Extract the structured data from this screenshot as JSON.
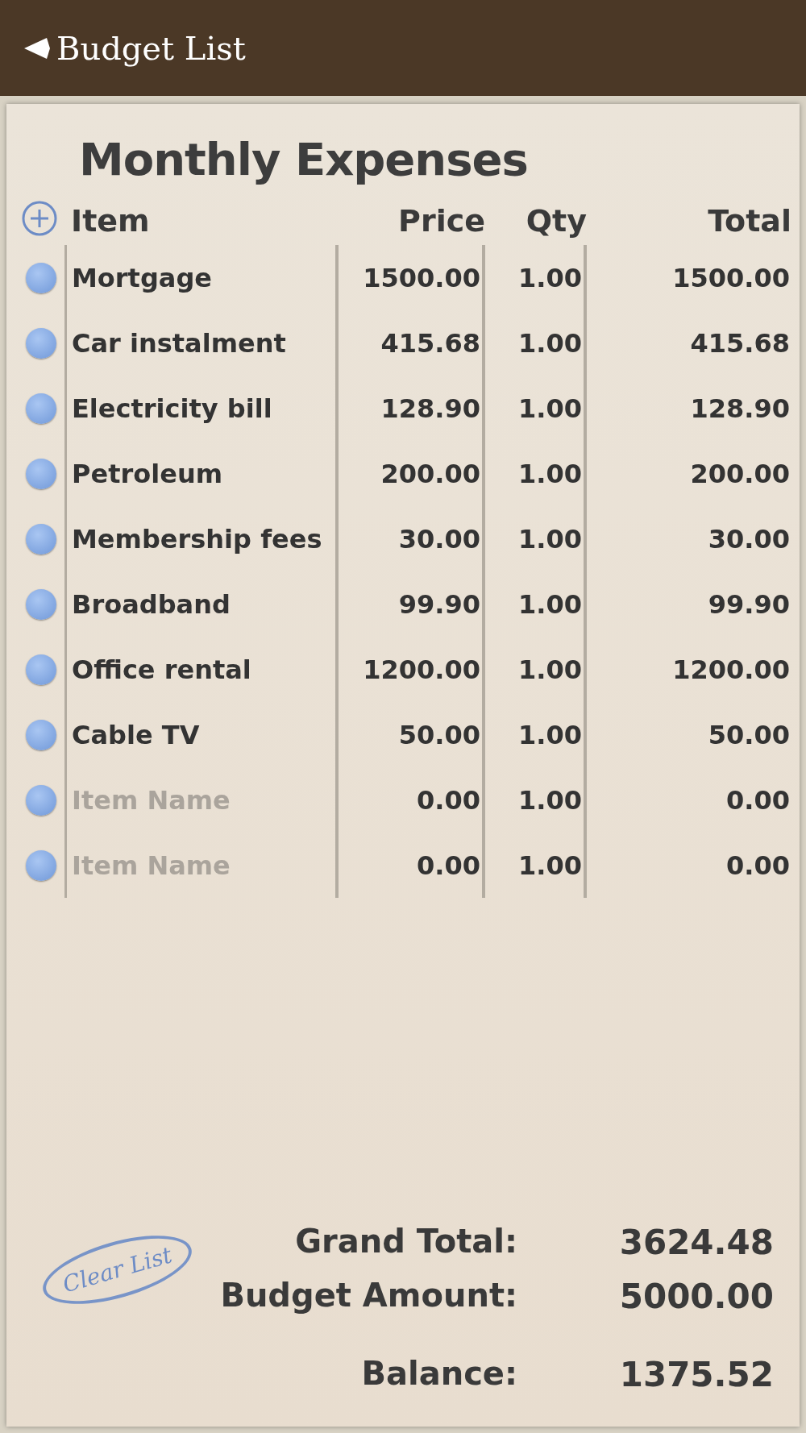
{
  "nav_bar": {
    "back_label": "Budget List"
  },
  "title": "Monthly Expenses",
  "columns": [
    "Item",
    "Price",
    "Qty",
    "Total"
  ],
  "rows": [
    {
      "name": "Mortgage",
      "price": "1500.00",
      "qty": "1.00",
      "total": "1500.00"
    },
    {
      "name": "Car instalment",
      "price": "415.68",
      "qty": "1.00",
      "total": "415.68"
    },
    {
      "name": "Electricity bill",
      "price": "128.90",
      "qty": "1.00",
      "total": "128.90"
    },
    {
      "name": "Petroleum",
      "price": "200.00",
      "qty": "1.00",
      "total": "200.00"
    },
    {
      "name": "Membership fees",
      "price": "30.00",
      "qty": "1.00",
      "total": "30.00"
    },
    {
      "name": "Broadband",
      "price": "99.90",
      "qty": "1.00",
      "total": "99.90"
    },
    {
      "name": "Office rental",
      "price": "1200.00",
      "qty": "1.00",
      "total": "1200.00"
    },
    {
      "name": "Cable TV",
      "price": "50.00",
      "qty": "1.00",
      "total": "50.00"
    },
    {
      "placeholder": "Item Name",
      "price": "0.00",
      "qty": "1.00",
      "total": "0.00"
    },
    {
      "placeholder": "Item Name",
      "price": "0.00",
      "qty": "1.00",
      "total": "0.00"
    }
  ],
  "clear_button": "Clear List",
  "summary": [
    {
      "label": "Grand Total:",
      "value": "3624.48"
    },
    {
      "label": "Budget Amount:",
      "value": "5000.00"
    },
    {
      "label": "Balance:",
      "value": "1375.52"
    }
  ]
}
